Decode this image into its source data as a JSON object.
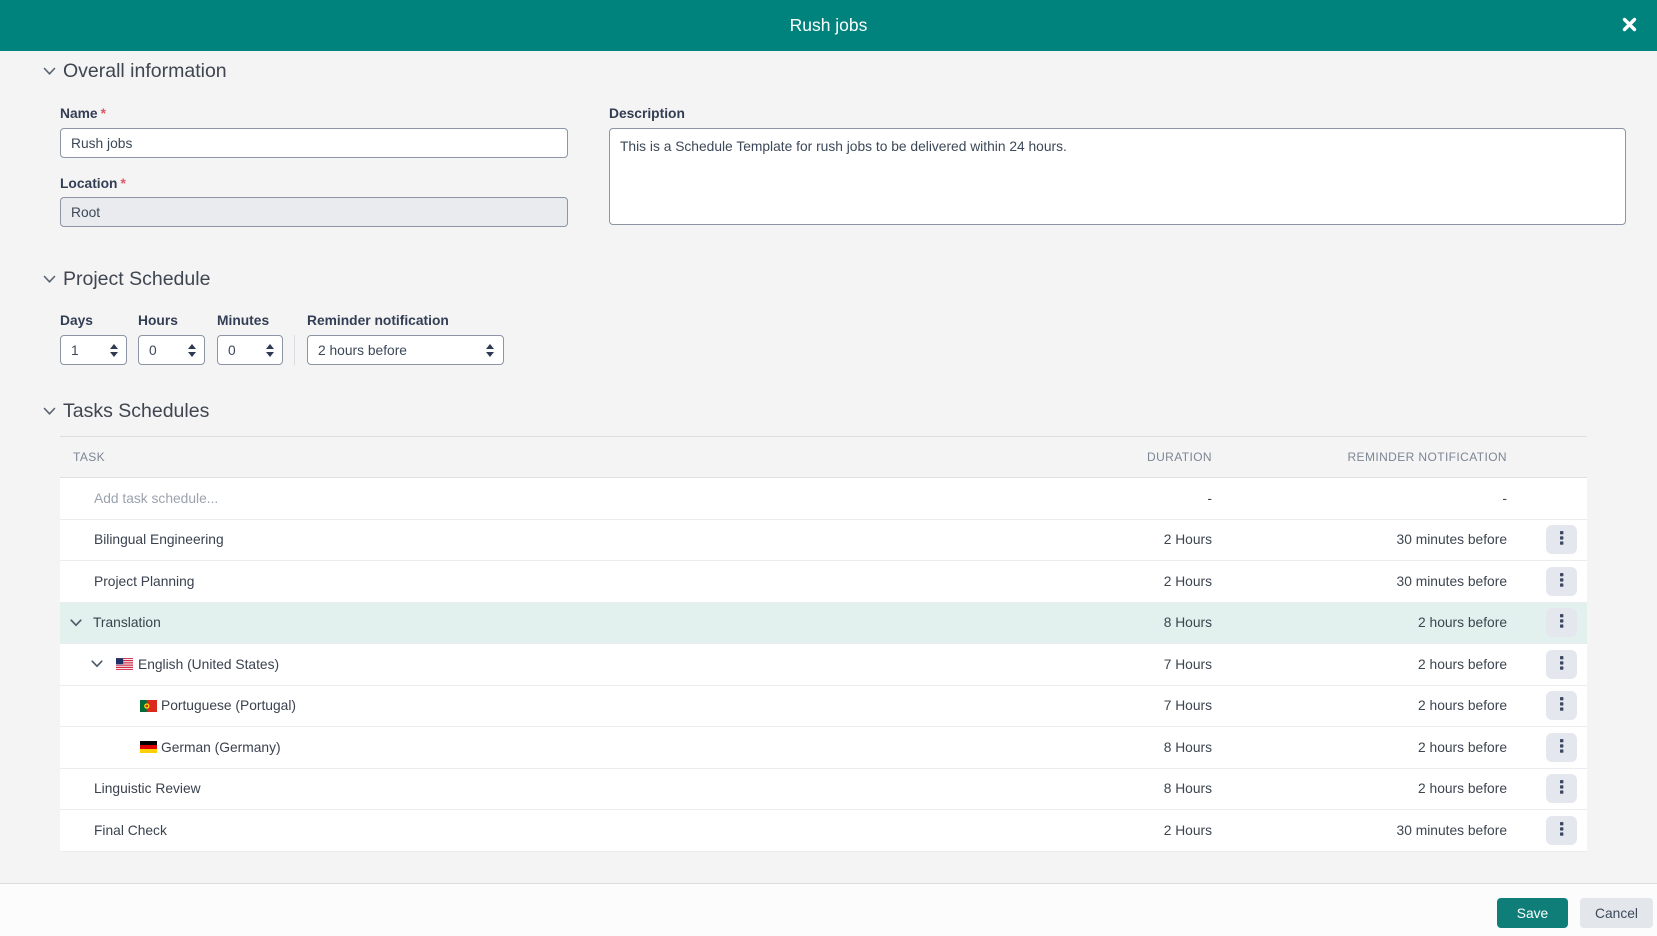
{
  "colors": {
    "accent_teal": "#00827D",
    "selected_row": "#E2F0EE"
  },
  "icons": {
    "close": "✕",
    "section_chevron": "⌄",
    "row_chevron": "⌄",
    "row_actions": "⋮",
    "stepper_arrows": "⇕"
  },
  "modal": {
    "title": "Rush jobs"
  },
  "sections": {
    "overall": {
      "title": "Overall information"
    },
    "schedule": {
      "title": "Project Schedule"
    },
    "tasks": {
      "title": "Tasks Schedules"
    }
  },
  "fields": {
    "name": {
      "label": "Name",
      "required_mark": "*",
      "value": "Rush jobs"
    },
    "location": {
      "label": "Location",
      "required_mark": "*",
      "value": "Root"
    },
    "description": {
      "label": "Description",
      "value": "This is a Schedule Template for rush jobs to be delivered within 24 hours."
    },
    "days": {
      "label": "Days",
      "value": "1"
    },
    "hours": {
      "label": "Hours",
      "value": "0"
    },
    "minutes": {
      "label": "Minutes",
      "value": "0"
    },
    "reminder": {
      "label": "Reminder notification",
      "value": "2 hours before"
    }
  },
  "table": {
    "columns": {
      "task": "TASK",
      "duration": "DURATION",
      "reminder": "REMINDER NOTIFICATION"
    },
    "add_row": {
      "placeholder": "Add task schedule...",
      "duration": "-",
      "reminder": "-"
    },
    "rows": [
      {
        "task": "Bilingual Engineering",
        "duration": "2 Hours",
        "reminder": "30 minutes before",
        "indent": 0,
        "chevron": false,
        "flag": null,
        "selected": false
      },
      {
        "task": "Project Planning",
        "duration": "2 Hours",
        "reminder": "30 minutes before",
        "indent": 0,
        "chevron": false,
        "flag": null,
        "selected": false
      },
      {
        "task": "Translation",
        "duration": "8 Hours",
        "reminder": "2 hours before",
        "indent": 0,
        "chevron": true,
        "flag": null,
        "selected": true
      },
      {
        "task": "English (United States)",
        "duration": "7 Hours",
        "reminder": "2 hours before",
        "indent": 1,
        "chevron": true,
        "flag": "us",
        "selected": false
      },
      {
        "task": "Portuguese (Portugal)",
        "duration": "7 Hours",
        "reminder": "2 hours before",
        "indent": 2,
        "chevron": false,
        "flag": "pt",
        "selected": false
      },
      {
        "task": "German (Germany)",
        "duration": "8 Hours",
        "reminder": "2 hours before",
        "indent": 2,
        "chevron": false,
        "flag": "de",
        "selected": false
      },
      {
        "task": "Linguistic Review",
        "duration": "8 Hours",
        "reminder": "2 hours before",
        "indent": 0,
        "chevron": false,
        "flag": null,
        "selected": false
      },
      {
        "task": "Final Check",
        "duration": "2 Hours",
        "reminder": "30 minutes before",
        "indent": 0,
        "chevron": false,
        "flag": null,
        "selected": false
      }
    ]
  },
  "footer": {
    "save_label": "Save",
    "cancel_label": "Cancel"
  }
}
